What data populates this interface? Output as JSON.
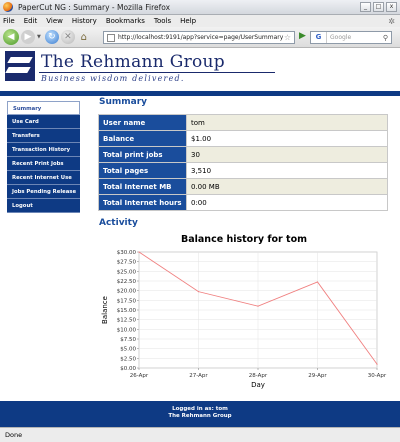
{
  "window": {
    "title": "PaperCut NG : Summary - Mozilla Firefox",
    "min": "_",
    "max": "□",
    "close": "x"
  },
  "menu": [
    "File",
    "Edit",
    "View",
    "History",
    "Bookmarks",
    "Tools",
    "Help"
  ],
  "toolbar": {
    "url": "http://localhost:9191/app?service=page/UserSummary",
    "search_placeholder": "Google",
    "search_engine": "G"
  },
  "header": {
    "brand": "The Rehmann Group",
    "tagline": "Business wisdom delivered."
  },
  "sidebar": {
    "items": [
      {
        "label": "Summary",
        "active": true
      },
      {
        "label": "Use Card",
        "active": false
      },
      {
        "label": "Transfers",
        "active": false
      },
      {
        "label": "Transaction History",
        "active": false
      },
      {
        "label": "Recent Print Jobs",
        "active": false
      },
      {
        "label": "Recent Internet Use",
        "active": false
      },
      {
        "label": "Jobs Pending Release",
        "active": false
      },
      {
        "label": "Logout",
        "active": false
      }
    ]
  },
  "summary": {
    "heading": "Summary",
    "rows": [
      {
        "label": "User name",
        "value": "tom"
      },
      {
        "label": "Balance",
        "value": "$1.00"
      },
      {
        "label": "Total print jobs",
        "value": "30"
      },
      {
        "label": "Total pages",
        "value": "3,510"
      },
      {
        "label": "Total Internet MB",
        "value": "0.00 MB"
      },
      {
        "label": "Total Internet hours",
        "value": "0:00"
      }
    ]
  },
  "activity": {
    "heading": "Activity"
  },
  "chart_data": {
    "type": "line",
    "title": "Balance history for tom",
    "xlabel": "Day",
    "ylabel": "Balance",
    "x": [
      "26-Apr",
      "27-Apr",
      "28-Apr",
      "29-Apr",
      "30-Apr"
    ],
    "series": [
      {
        "values": [
          30.0,
          19.75,
          16.0,
          22.25,
          1.0
        ]
      }
    ],
    "ylim": [
      0,
      30
    ],
    "yticks": [
      "$0.00",
      "$2.50",
      "$5.00",
      "$7.50",
      "$10.00",
      "$12.50",
      "$15.00",
      "$17.50",
      "$20.00",
      "$22.50",
      "$25.00",
      "$27.50",
      "$30.00"
    ],
    "grid": true,
    "line_color": "#f08080"
  },
  "footer": {
    "line1": "Logged in as:  tom",
    "line2": "The Rehmann Group"
  },
  "status": "Done",
  "colors": {
    "brand": "#0e3a84",
    "heading": "#1a4d9c",
    "shade": "#eeeddf"
  }
}
